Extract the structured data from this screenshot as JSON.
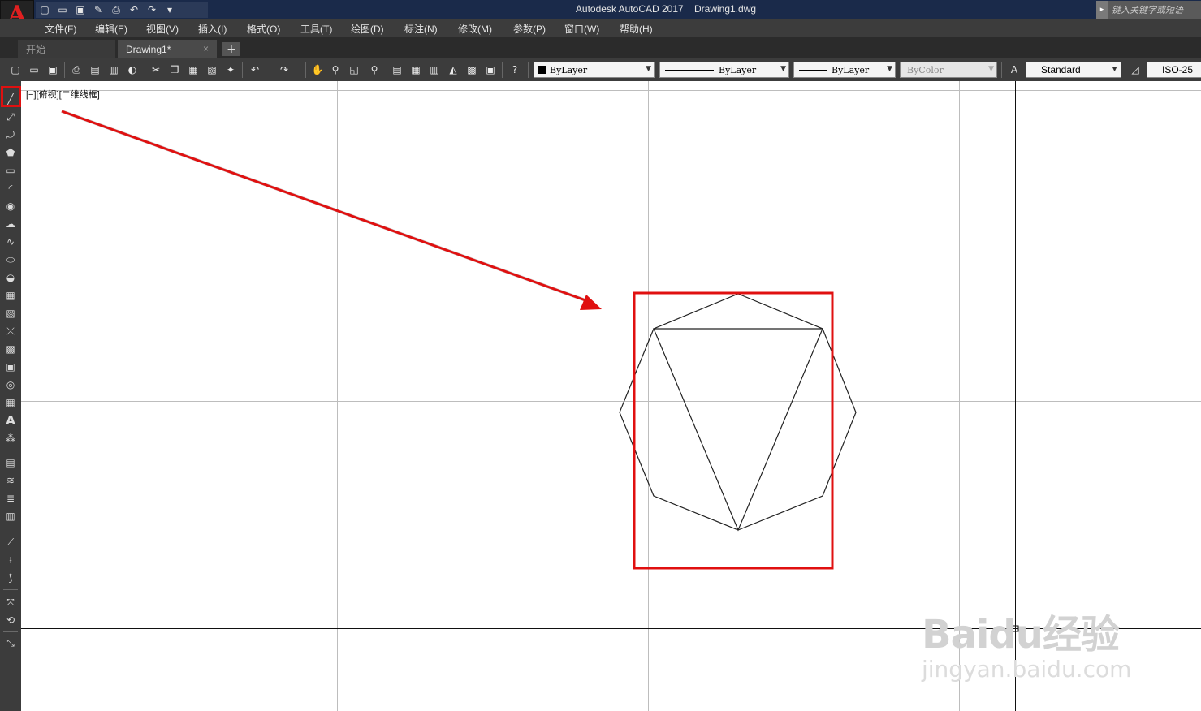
{
  "app": {
    "logo_letter": "A",
    "title": "Autodesk AutoCAD 2017    Drawing1.dwg",
    "search_placeholder": "键入关键字或短语"
  },
  "quick_access": [
    "new-icon",
    "open-icon",
    "save-icon",
    "saveas-icon",
    "plot-icon",
    "undo-icon",
    "redo-icon",
    "customize-icon"
  ],
  "menu": [
    "文件(F)",
    "编辑(E)",
    "视图(V)",
    "插入(I)",
    "格式(O)",
    "工具(T)",
    "绘图(D)",
    "标注(N)",
    "修改(M)",
    "参数(P)",
    "窗口(W)",
    "帮助(H)"
  ],
  "tabs": {
    "start": "开始",
    "drawing": "Drawing1*",
    "close": "×",
    "add": "+"
  },
  "properties": {
    "color": "ByLayer",
    "linetype": "ByLayer",
    "lineweight": "ByLayer",
    "plotstyle": "ByColor",
    "text_style": "Standard",
    "dim_style": "ISO-25"
  },
  "viewport": {
    "label": "[−][俯视][二维线框]"
  },
  "annotation_colors": {
    "highlight": "#e01010"
  },
  "watermark": {
    "brand": "Baidu经验",
    "url": "jingyan.baidu.com"
  }
}
